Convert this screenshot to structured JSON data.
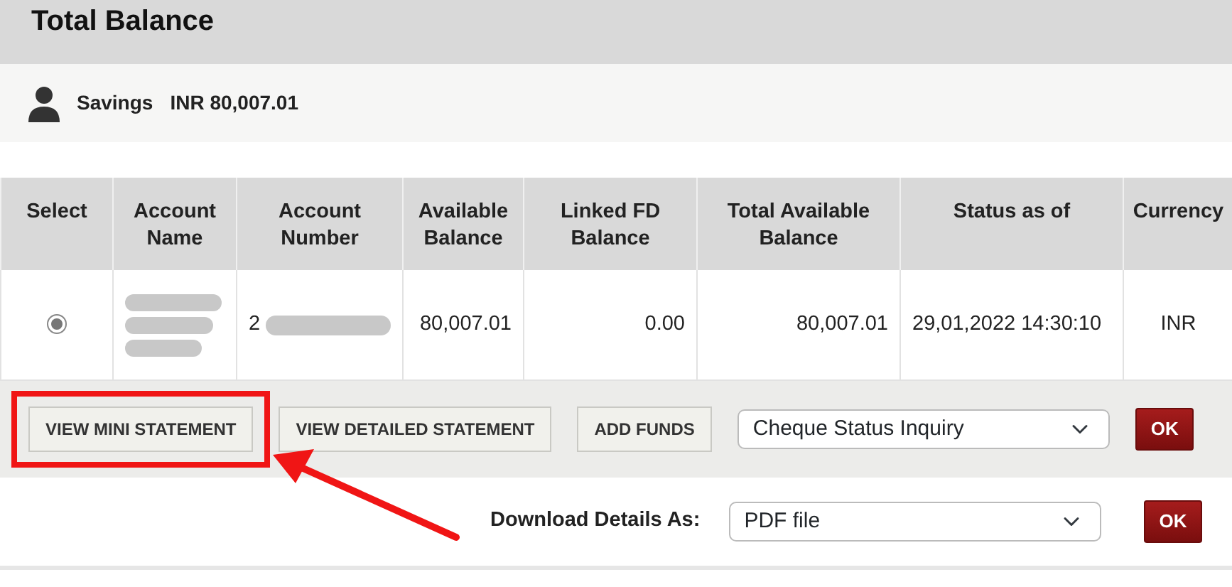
{
  "header": {
    "title": "Total Balance"
  },
  "account_summary": {
    "type": "Savings",
    "amount": "INR 80,007.01"
  },
  "table": {
    "columns": [
      "Select",
      "Account Name",
      "Account Number",
      "Available Balance",
      "Linked FD Balance",
      "Total Available Balance",
      "Status as of",
      "Currency"
    ],
    "rows": [
      {
        "selected": true,
        "account_name_redacted": true,
        "account_number": "2",
        "account_number_redacted": true,
        "available_balance": "80,007.01",
        "linked_fd_balance": "0.00",
        "total_available_balance": "80,007.01",
        "status_as_of": "29,01,2022 14:30:10",
        "currency": "INR"
      }
    ]
  },
  "actions": {
    "buttons": [
      {
        "label": "VIEW MINI STATEMENT",
        "highlighted": true
      },
      {
        "label": "VIEW DETAILED STATEMENT",
        "highlighted": false
      },
      {
        "label": "ADD FUNDS",
        "highlighted": false
      }
    ],
    "inquiry_select": {
      "value": "Cheque Status Inquiry"
    },
    "ok": "OK"
  },
  "download": {
    "label": "Download Details As:",
    "select": {
      "value": "PDF file"
    },
    "ok": "OK"
  }
}
